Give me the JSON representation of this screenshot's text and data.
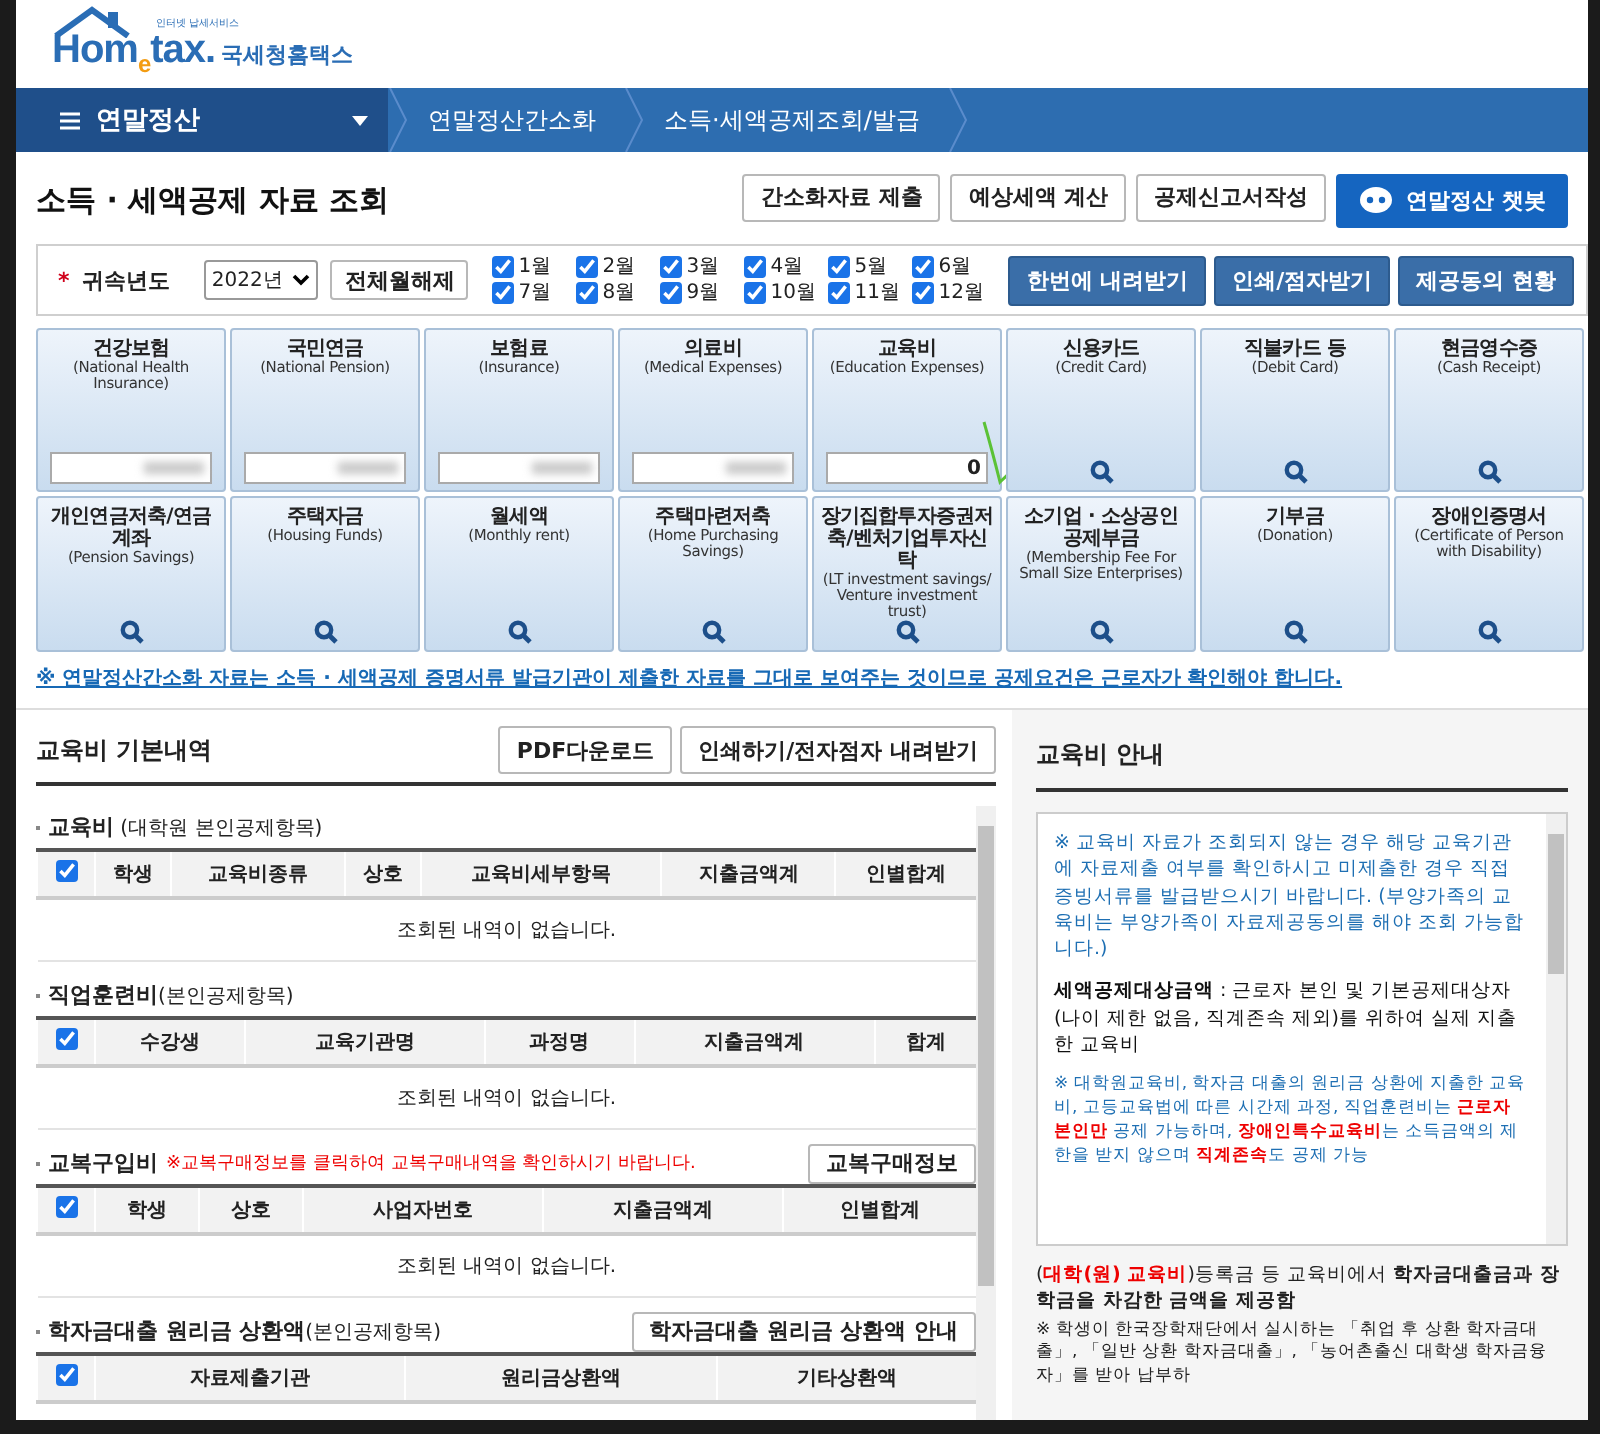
{
  "header": {
    "logo_text": "Hom$_{e}$tax.",
    "tagline": "인터넷 납세서비스",
    "site_name": "국세청홈택스"
  },
  "nav": {
    "menu": "연말정산",
    "breadcrumbs": [
      "연말정산간소화",
      "소득·세액공제조회/발급"
    ]
  },
  "page_title": "소득 · 세액공제 자료 조회",
  "top_buttons": [
    "간소화자료 제출",
    "예상세액 계산",
    "공제신고서작성"
  ],
  "chatbot_button": "연말정산 챗봇",
  "filter": {
    "label": "귀속년도",
    "required_mark": "*",
    "year": "2022년",
    "clear_button": "전체월해제",
    "months": [
      {
        "label": "1월",
        "checked": true
      },
      {
        "label": "2월",
        "checked": true
      },
      {
        "label": "3월",
        "checked": true
      },
      {
        "label": "4월",
        "checked": true
      },
      {
        "label": "5월",
        "checked": true
      },
      {
        "label": "6월",
        "checked": true
      },
      {
        "label": "7월",
        "checked": true
      },
      {
        "label": "8월",
        "checked": true
      },
      {
        "label": "9월",
        "checked": true
      },
      {
        "label": "10월",
        "checked": true
      },
      {
        "label": "11월",
        "checked": true
      },
      {
        "label": "12월",
        "checked": true
      }
    ],
    "buttons": [
      "한번에 내려받기",
      "인쇄/점자받기",
      "제공동의 현황"
    ]
  },
  "cards": [
    {
      "title": "건강보험",
      "subtitle": "(National Health Insurance)",
      "kind": "blurred"
    },
    {
      "title": "국민연금",
      "subtitle": "(National Pension)",
      "kind": "blurred"
    },
    {
      "title": "보험료",
      "subtitle": "(Insurance)",
      "kind": "blurred"
    },
    {
      "title": "의료비",
      "subtitle": "(Medical Expenses)",
      "kind": "blurred"
    },
    {
      "title": "교육비",
      "subtitle": "(Education Expenses)",
      "kind": "value",
      "value": "0"
    },
    {
      "title": "신용카드",
      "subtitle": "(Credit Card)",
      "kind": "search"
    },
    {
      "title": "직불카드 등",
      "subtitle": "(Debit Card)",
      "kind": "search"
    },
    {
      "title": "현금영수증",
      "subtitle": "(Cash Receipt)",
      "kind": "search"
    },
    {
      "title": "개인연금저축/연금계좌",
      "subtitle": "(Pension Savings)",
      "kind": "search"
    },
    {
      "title": "주택자금",
      "subtitle": "(Housing Funds)",
      "kind": "search"
    },
    {
      "title": "월세액",
      "subtitle": "(Monthly rent)",
      "kind": "search"
    },
    {
      "title": "주택마련저축",
      "subtitle": "(Home Purchasing Savings)",
      "kind": "search"
    },
    {
      "title": "장기집합투자증권저축/벤처기업투자신탁",
      "subtitle": "(LT investment savings/ Venture investment trust)",
      "kind": "search"
    },
    {
      "title": "소기업 · 소상공인 공제부금",
      "subtitle": "(Membership Fee For Small Size Enterprises)",
      "kind": "search"
    },
    {
      "title": "기부금",
      "subtitle": "(Donation)",
      "kind": "search"
    },
    {
      "title": "장애인증명서",
      "subtitle": "(Certificate of Person with Disability)",
      "kind": "search"
    }
  ],
  "notice_link": "※ 연말정산간소화 자료는 소득 · 세액공제 증명서류 발급기관이 제출한 자료를 그대로 보여주는 것이므로 공제요건은 근로자가 확인해야 합니다.",
  "detail": {
    "title": "교육비 기본내역",
    "buttons": [
      "PDF다운로드",
      "인쇄하기/전자점자 내려받기"
    ],
    "sections": [
      {
        "title": "교육비",
        "suffix": " (대학원 본인공제항목)",
        "all_checked": true,
        "columns": [
          "학생",
          "교육비종류",
          "상호",
          "교육비세부항목",
          "지출금액계",
          "인별합계"
        ],
        "empty_text": "조회된 내역이 없습니다."
      },
      {
        "title": "직업훈련비",
        "suffix": "(본인공제항목)",
        "all_checked": true,
        "columns": [
          "수강생",
          "교육기관명",
          "과정명",
          "지출금액계",
          "합계"
        ],
        "empty_text": "조회된 내역이 없습니다."
      },
      {
        "title": "교복구입비",
        "warning": "※교복구매정보를 클릭하여 교복구매내역을 확인하시기 바랍니다.",
        "button": "교복구매정보",
        "all_checked": true,
        "columns": [
          "학생",
          "상호",
          "사업자번호",
          "지출금액계",
          "인별합계"
        ],
        "empty_text": "조회된 내역이 없습니다."
      },
      {
        "title": "학자금대출 원리금 상환액",
        "suffix": "(본인공제항목)",
        "button": "학자금대출 원리금 상환액 안내",
        "all_checked": true,
        "columns": [
          "자료제출기관",
          "원리금상환액",
          "기타상환액"
        ]
      }
    ]
  },
  "guide": {
    "title": "교육비 안내",
    "box_paragraphs": [
      {
        "kind": "info",
        "parts": [
          {
            "kind": "plain",
            "text": "※ 교육비 자료가 조회되지 않는 경우 해당 교육기관에 자료제출 여부를 확인하시고 미제출한 경우 직접 증빙서류를 발급받으시기 바랍니다. (부양가족의 교육비는 부양가족이 자료제공동의를 해야 조회 가능합니다.)"
          }
        ]
      },
      {
        "kind": "body",
        "parts": [
          {
            "kind": "bold",
            "text": "세액공제대상금액"
          },
          {
            "kind": "plain",
            "text": " : 근로자 본인 및 기본공제대상자(나이 제한 없음, 직계존속 제외)를 위하여 실제 지출한 교육비"
          }
        ]
      },
      {
        "kind": "note",
        "parts": [
          {
            "kind": "plain",
            "text": "※ 대학원교육비, 학자금 대출의 원리금 상환에 지출한 교육비, 고등교육법에 따른 시간제 과정, 직업훈련비는 "
          },
          {
            "kind": "red",
            "text": "근로자 본인만"
          },
          {
            "kind": "plain",
            "text": " 공제 가능하며, "
          },
          {
            "kind": "red",
            "text": "장애인특수교육비"
          },
          {
            "kind": "plain",
            "text": "는 소득금액의 제한을 받지 않으며 "
          },
          {
            "kind": "red",
            "text": "직계존속"
          },
          {
            "kind": "plain",
            "text": "도 공제 가능"
          }
        ]
      }
    ],
    "bullets": [
      {
        "parts": [
          {
            "kind": "plain",
            "text": "("
          },
          {
            "kind": "red",
            "text": "대학(원) 교육비"
          },
          {
            "kind": "plain",
            "text": ")등록금 등 교육비에서 "
          },
          {
            "kind": "bold",
            "text": "학자금대출금과 장학금을 차감한 금액을 제공함"
          }
        ]
      }
    ],
    "footnote": "※ 학생이 한국장학재단에서 실시하는 「취업 후 상환 학자금대출」, 「일반 상환 학자금대출」, 「농어촌출신 대학생 학자금융자」를 받아 납부하"
  }
}
